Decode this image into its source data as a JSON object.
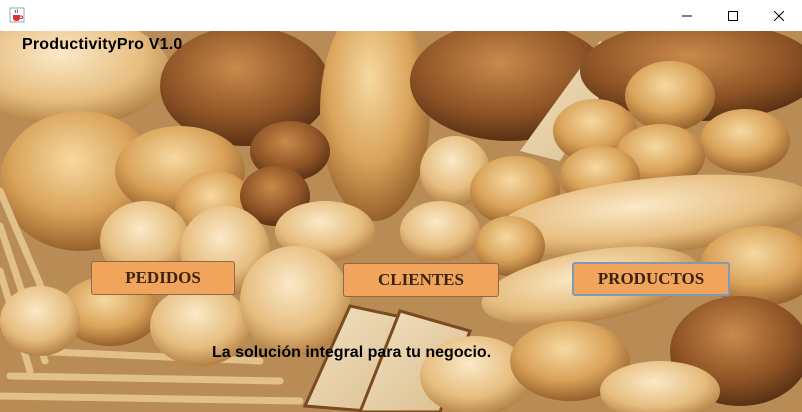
{
  "window": {
    "icon": "java-cup-icon",
    "controls": {
      "minimize": "minimize-icon",
      "maximize": "maximize-icon",
      "close": "close-icon"
    }
  },
  "app": {
    "title": "ProductivityPro V1.0",
    "tagline": "La solución integral para tu negocio."
  },
  "buttons": {
    "pedidos": "PEDIDOS",
    "clientes": "CLIENTES",
    "productos": "PRODUCTOS"
  },
  "colors": {
    "button_fill": "#f0a45c",
    "button_text": "#3a2410",
    "focus_border": "#7f99b8"
  },
  "background": "bread-assortment-photo"
}
